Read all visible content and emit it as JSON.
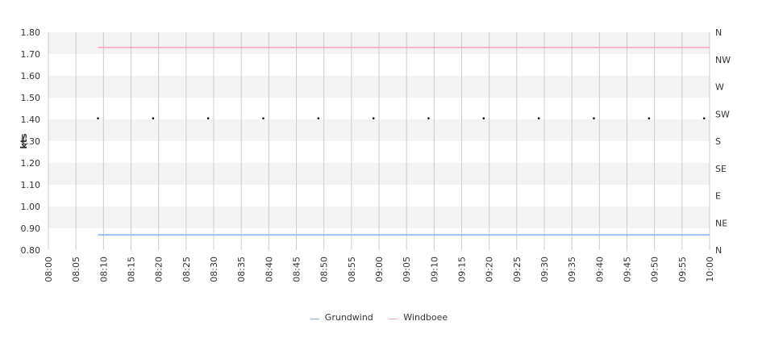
{
  "chart_data": {
    "type": "line",
    "ylabel": "kts",
    "ylim": [
      0.8,
      1.8
    ],
    "yticks": [
      "1.80",
      "1.70",
      "1.60",
      "1.50",
      "1.40",
      "1.30",
      "1.20",
      "1.10",
      "1.00",
      "0.90",
      "0.80"
    ],
    "direction_ticks": [
      "N",
      "NW",
      "W",
      "SW",
      "S",
      "SE",
      "E",
      "NE",
      "N"
    ],
    "x_range": [
      "08:00",
      "10:00"
    ],
    "xticks": [
      "08:00",
      "08:05",
      "08:10",
      "08:15",
      "08:20",
      "08:25",
      "08:30",
      "08:35",
      "08:40",
      "08:45",
      "08:50",
      "08:55",
      "09:00",
      "09:05",
      "09:10",
      "09:15",
      "09:20",
      "09:25",
      "09:30",
      "09:35",
      "09:40",
      "09:45",
      "09:50",
      "09:55",
      "10:00"
    ],
    "grid": true,
    "legend_position": "bottom",
    "series": [
      {
        "name": "Grundwind",
        "color": "#7cb5ec",
        "x": [
          "08:09",
          "10:00"
        ],
        "y": [
          0.87,
          0.87
        ]
      },
      {
        "name": "Windboee",
        "color": "#f7a3bf",
        "x": [
          "08:09",
          "10:00"
        ],
        "y": [
          1.73,
          1.73
        ]
      }
    ],
    "direction_points": {
      "color": "#000000",
      "x": [
        "08:09",
        "08:19",
        "08:29",
        "08:39",
        "08:49",
        "08:59",
        "09:09",
        "09:19",
        "09:29",
        "09:39",
        "09:49",
        "09:59"
      ],
      "y": [
        1.405,
        1.405,
        1.405,
        1.405,
        1.405,
        1.405,
        1.405,
        1.405,
        1.405,
        1.405,
        1.405,
        1.405
      ]
    }
  }
}
